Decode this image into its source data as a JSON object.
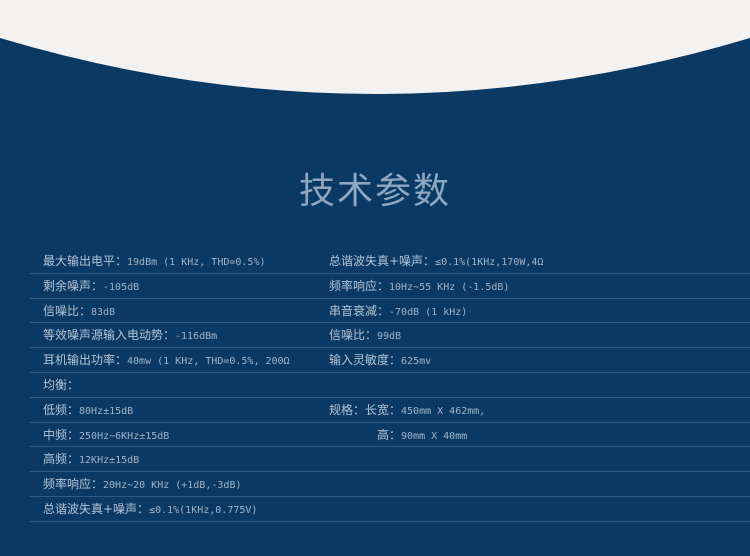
{
  "title": "技术参数",
  "left": [
    {
      "k": "最大输出电平：",
      "v": "19dBm (1 KHz, THD=0.5%)"
    },
    {
      "k": "剩余噪声：",
      "v": "-105dB"
    },
    {
      "k": "信噪比：",
      "v": "83dB"
    },
    {
      "k": "等效噪声源输入电动势：",
      "v": "-116dBm"
    },
    {
      "k": "耳机输出功率：",
      "v": "40mw (1 KHz, THD=0.5%, 200Ω"
    },
    {
      "k": "均衡：",
      "v": ""
    },
    {
      "k": "低频：",
      "v": "80Hz±15dB"
    },
    {
      "k": "中频：",
      "v": "250Hz~6KHz±15dB"
    },
    {
      "k": "高频：",
      "v": "12KHz±15dB"
    },
    {
      "k": "频率响应：",
      "v": "20Hz~20 KHz (+1dB,-3dB)"
    },
    {
      "k": "总谐波失真+噪声：",
      "v": "≤0.1%(1KHz,0.775V)"
    }
  ],
  "right": [
    {
      "k": "总谐波失真+噪声：",
      "v": "≤0.1%(1KHz,170W,4Ω"
    },
    {
      "k": "频率响应：",
      "v": "10Hz~55 KHz (-1.5dB)"
    },
    {
      "k": "串音衰减：",
      "v": "-70dB (1 kHz)"
    },
    {
      "k": "信噪比：",
      "v": "99dB"
    },
    {
      "k": "输入灵敏度：",
      "v": "625mv"
    },
    {
      "k": "",
      "v": ""
    },
    {
      "k": "规格：长宽：",
      "v": "450mm X 462mm,"
    },
    {
      "k": "高：",
      "v": "90mm X 40mm",
      "indent": true
    },
    {
      "k": "",
      "v": ""
    },
    {
      "k": "",
      "v": ""
    },
    {
      "k": "",
      "v": ""
    }
  ]
}
